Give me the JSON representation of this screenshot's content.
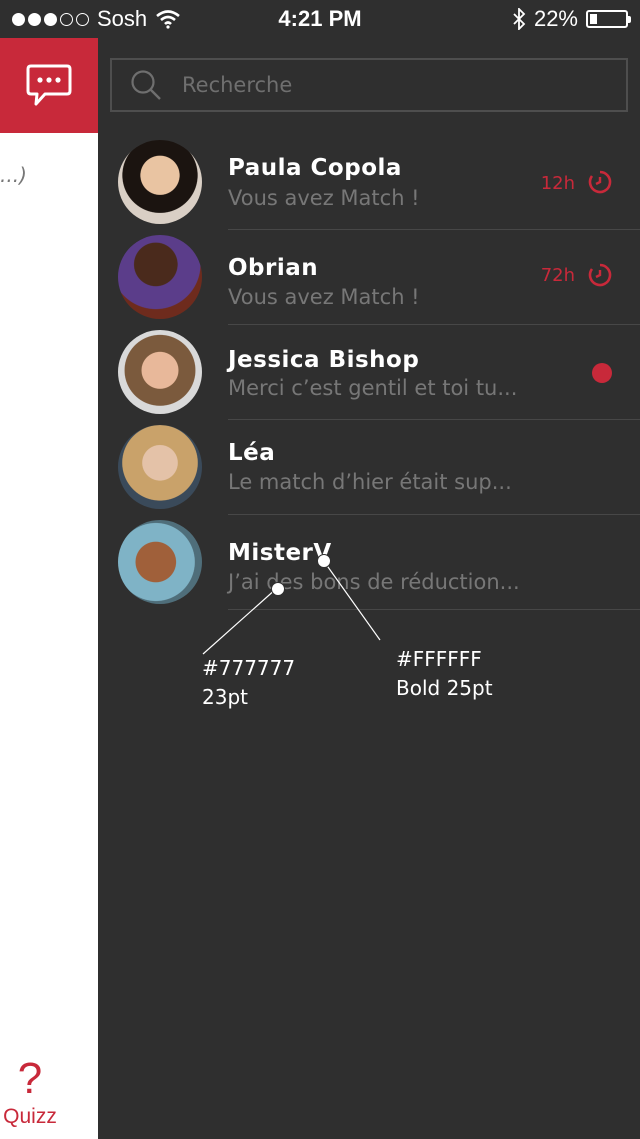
{
  "status": {
    "carrier": "Sosh",
    "signal_filled": 3,
    "signal_total": 5,
    "time": "4:21 PM",
    "battery_text": "22%",
    "battery_level": 0.22
  },
  "left": {
    "snippet": "...)",
    "quizz_icon": "?",
    "quizz_label": "Quizz"
  },
  "search": {
    "placeholder": "Recherche",
    "value": ""
  },
  "conversations": [
    {
      "name": "Paula Copola",
      "message": "Vous avez Match !",
      "time": "12h",
      "indicator": "timer"
    },
    {
      "name": "Obrian",
      "message": "Vous avez Match !",
      "time": "72h",
      "indicator": "timer"
    },
    {
      "name": "Jessica Bishop",
      "message": "Merci c’est gentil et toi tu...",
      "time": "",
      "indicator": "unread"
    },
    {
      "name": "Léa",
      "message": "Le match d’hier était sup...",
      "time": "",
      "indicator": "none"
    },
    {
      "name": "MisterV",
      "message": "J’ai des bons de réduction...",
      "time": "",
      "indicator": "none"
    }
  ],
  "annotations": {
    "message_style": {
      "line1": "#777777",
      "line2": "23pt"
    },
    "name_style": {
      "line1": "#FFFFFF",
      "line2": "Bold 25pt"
    }
  },
  "colors": {
    "accent": "#c8293a",
    "background": "#2f2f2f",
    "message_text": "#777777",
    "name_text": "#FFFFFF"
  }
}
